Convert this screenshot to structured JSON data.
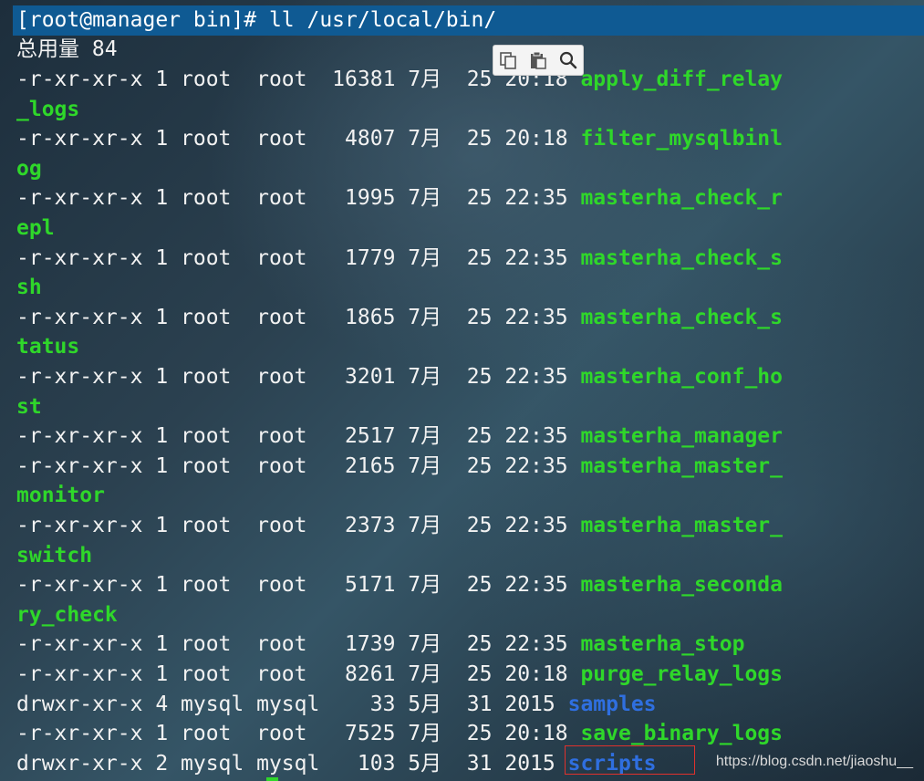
{
  "prompt": "[root@manager bin]# ll /usr/local/bin/",
  "total_line": "总用量 84",
  "lines": [
    {
      "meta": "-r-xr-xr-x 1 root  root  16381 7月  25 20:18 ",
      "name": "apply_diff_relay",
      "cls": "exec"
    },
    {
      "meta": "",
      "name": "_logs",
      "cls": "exec"
    },
    {
      "meta": "-r-xr-xr-x 1 root  root   4807 7月  25 20:18 ",
      "name": "filter_mysqlbinl",
      "cls": "exec"
    },
    {
      "meta": "",
      "name": "og",
      "cls": "exec"
    },
    {
      "meta": "-r-xr-xr-x 1 root  root   1995 7月  25 22:35 ",
      "name": "masterha_check_r",
      "cls": "exec"
    },
    {
      "meta": "",
      "name": "epl",
      "cls": "exec"
    },
    {
      "meta": "-r-xr-xr-x 1 root  root   1779 7月  25 22:35 ",
      "name": "masterha_check_s",
      "cls": "exec"
    },
    {
      "meta": "",
      "name": "sh",
      "cls": "exec"
    },
    {
      "meta": "-r-xr-xr-x 1 root  root   1865 7月  25 22:35 ",
      "name": "masterha_check_s",
      "cls": "exec"
    },
    {
      "meta": "",
      "name": "tatus",
      "cls": "exec"
    },
    {
      "meta": "-r-xr-xr-x 1 root  root   3201 7月  25 22:35 ",
      "name": "masterha_conf_ho",
      "cls": "exec"
    },
    {
      "meta": "",
      "name": "st",
      "cls": "exec"
    },
    {
      "meta": "-r-xr-xr-x 1 root  root   2517 7月  25 22:35 ",
      "name": "masterha_manager",
      "cls": "exec"
    },
    {
      "meta": "-r-xr-xr-x 1 root  root   2165 7月  25 22:35 ",
      "name": "masterha_master_",
      "cls": "exec"
    },
    {
      "meta": "",
      "name": "monitor",
      "cls": "exec"
    },
    {
      "meta": "-r-xr-xr-x 1 root  root   2373 7月  25 22:35 ",
      "name": "masterha_master_",
      "cls": "exec"
    },
    {
      "meta": "",
      "name": "switch",
      "cls": "exec"
    },
    {
      "meta": "-r-xr-xr-x 1 root  root   5171 7月  25 22:35 ",
      "name": "masterha_seconda",
      "cls": "exec"
    },
    {
      "meta": "",
      "name": "ry_check",
      "cls": "exec"
    },
    {
      "meta": "-r-xr-xr-x 1 root  root   1739 7月  25 22:35 ",
      "name": "masterha_stop",
      "cls": "exec"
    },
    {
      "meta": "-r-xr-xr-x 1 root  root   8261 7月  25 20:18 ",
      "name": "purge_relay_logs",
      "cls": "exec"
    },
    {
      "meta": "drwxr-xr-x 4 mysql mysql    33 5月  31 2015 ",
      "name": "samples",
      "cls": "dir"
    },
    {
      "meta": "-r-xr-xr-x 1 root  root   7525 7月  25 20:18 ",
      "name": "save_binary_logs",
      "cls": "exec"
    },
    {
      "meta": "drwxr-xr-x 2 mysql mysql   103 5月  31 2015 ",
      "name": "scripts",
      "cls": "dir"
    }
  ],
  "watermark": "https://blog.csdn.net/jiaoshu__",
  "colors": {
    "executable": "#2fd72a",
    "directory": "#2f6fe0",
    "prompt_bar": "#0f5a93",
    "highlight": "#e0312c"
  },
  "toolbar_icons": [
    "copy-icon",
    "paste-icon",
    "search-icon"
  ]
}
